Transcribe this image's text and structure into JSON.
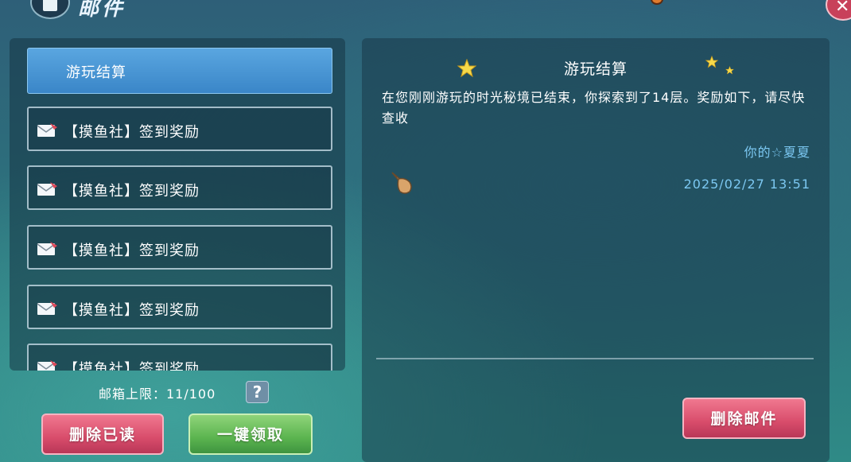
{
  "header": {
    "title": "邮件"
  },
  "mail_list": {
    "items": [
      {
        "label": "游玩结算",
        "selected": true
      },
      {
        "label": "【摸鱼社】签到奖励"
      },
      {
        "label": "【摸鱼社】签到奖励"
      },
      {
        "label": "【摸鱼社】签到奖励"
      },
      {
        "label": "【摸鱼社】签到奖励"
      },
      {
        "label": "【摸鱼社】签到奖励"
      }
    ]
  },
  "mailbox": {
    "limit_label": "邮箱上限：11/100",
    "help_label": "?"
  },
  "actions": {
    "delete_read": "删除已读",
    "claim_all": "一键领取",
    "delete_mail": "删除邮件"
  },
  "detail": {
    "title": "游玩结算",
    "body": "在您刚刚游玩的时光秘境已结束，你探索到了14层。奖励如下，请尽快查收",
    "sender": "你的☆夏夏",
    "date": "2025/02/27 13:51"
  },
  "colors": {
    "selected_item": "#3a86c8",
    "red_button": "#d84c6b",
    "green_button": "#5bb44f",
    "sender_text": "#7cc8f2"
  },
  "icons": [
    "envelope-icon",
    "help-icon",
    "close-icon",
    "star-icon",
    "pointer-hand-icon"
  ]
}
